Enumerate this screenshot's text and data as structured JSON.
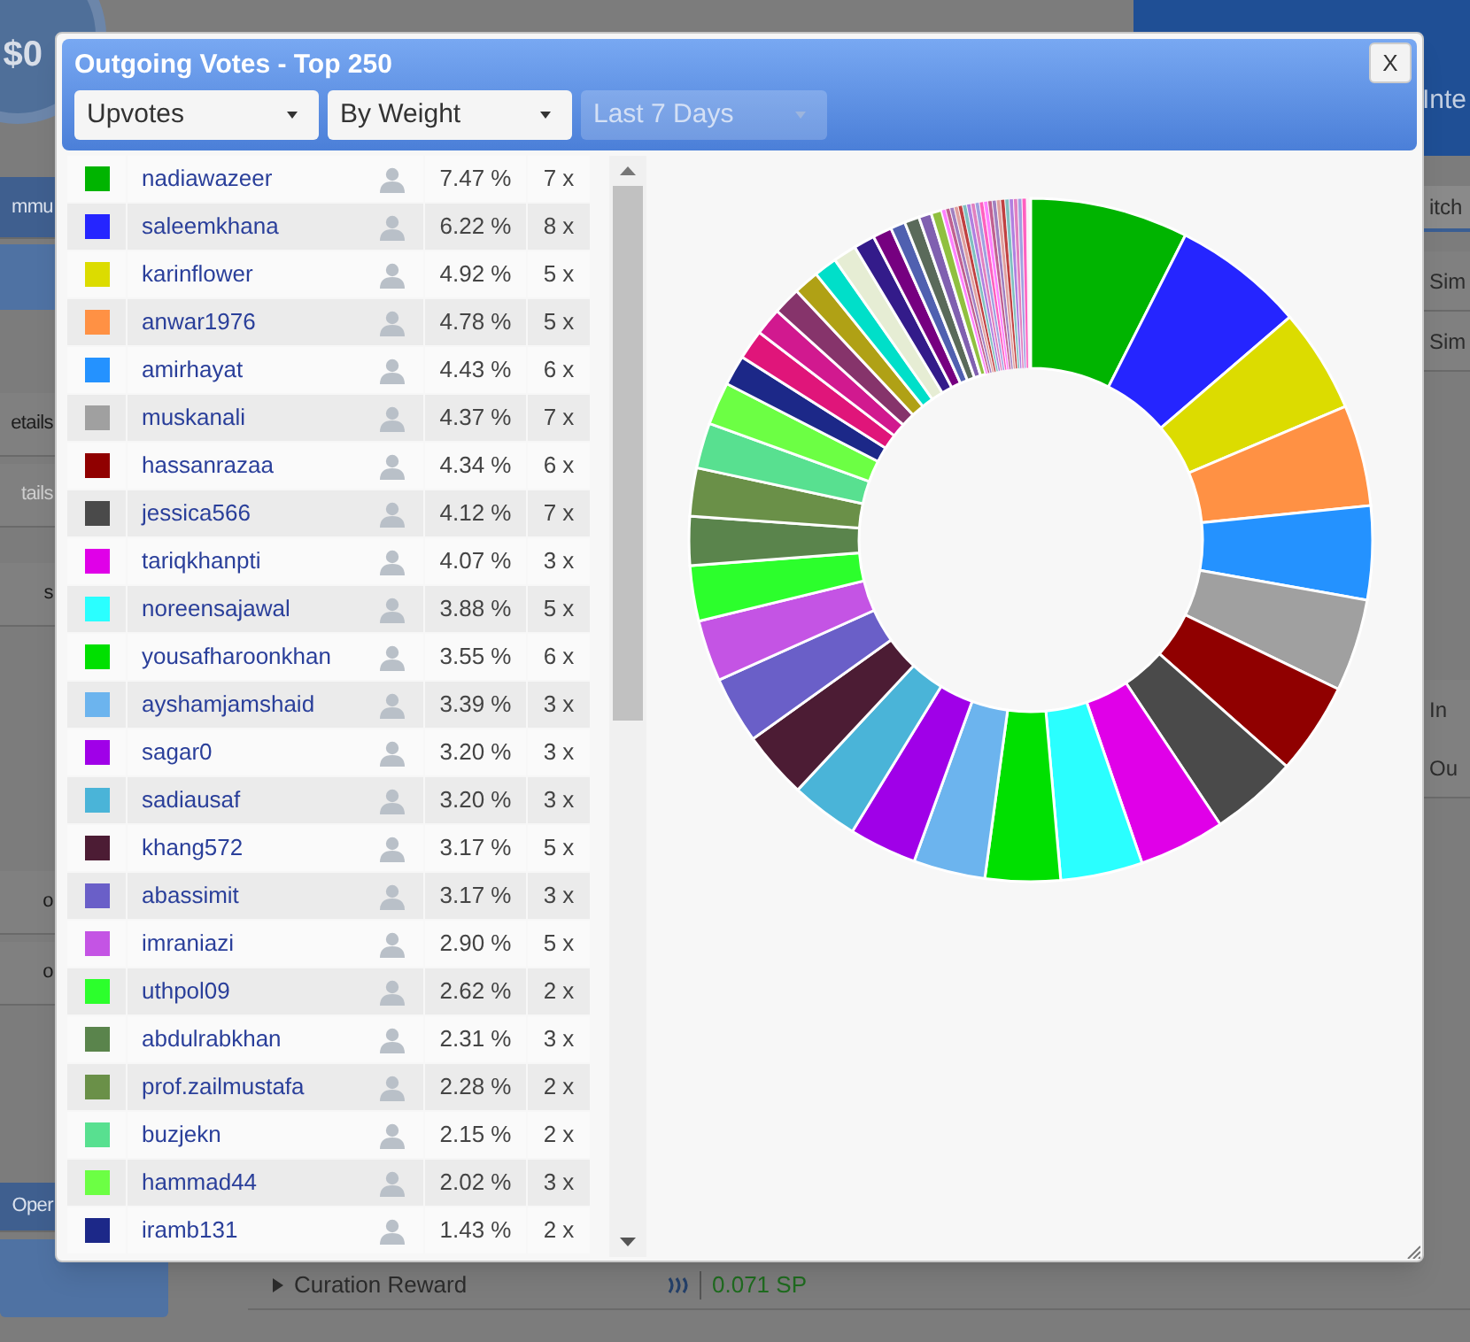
{
  "background_page": {
    "banner": {
      "caption": "Inte"
    },
    "balance": "$0",
    "left_items": [
      {
        "label": "mmu",
        "disabled": false
      },
      {
        "label": "etails",
        "disabled": false
      },
      {
        "label": "tails",
        "disabled": true
      },
      {
        "label": "s",
        "disabled": false
      },
      {
        "label": "o",
        "disabled": false
      },
      {
        "label": "o",
        "disabled": false
      },
      {
        "label": "Oper",
        "disabled": false
      }
    ],
    "right_items": [
      {
        "label": "itch"
      },
      {
        "label": "Sim"
      },
      {
        "label": "Sim"
      },
      {
        "label": "In"
      },
      {
        "label": "Ou"
      }
    ],
    "reward": {
      "label": "Curation Reward",
      "value": "0.071 SP"
    }
  },
  "dialog": {
    "title": "Outgoing Votes - Top 250",
    "close_label": "X",
    "filters": [
      {
        "value": "Upvotes",
        "disabled": false
      },
      {
        "value": "By Weight",
        "disabled": false
      },
      {
        "value": "Last 7 Days",
        "disabled": true
      }
    ]
  },
  "voters": [
    {
      "color": "#00b400",
      "name": "nadiawazeer",
      "share": "7.47 %",
      "votes": "7 x"
    },
    {
      "color": "#2525ff",
      "name": "saleemkhana",
      "share": "6.22 %",
      "votes": "8 x"
    },
    {
      "color": "#dcdc00",
      "name": "karinflower",
      "share": "4.92 %",
      "votes": "5 x"
    },
    {
      "color": "#ff9144",
      "name": "anwar1976",
      "share": "4.78 %",
      "votes": "5 x"
    },
    {
      "color": "#2492ff",
      "name": "amirhayat",
      "share": "4.43 %",
      "votes": "6 x"
    },
    {
      "color": "#a0a0a0",
      "name": "muskanali",
      "share": "4.37 %",
      "votes": "7 x"
    },
    {
      "color": "#900000",
      "name": "hassanrazaa",
      "share": "4.34 %",
      "votes": "6 x"
    },
    {
      "color": "#4a4a4a",
      "name": "jessica566",
      "share": "4.12 %",
      "votes": "7 x"
    },
    {
      "color": "#e000e8",
      "name": "tariqkhanpti",
      "share": "4.07 %",
      "votes": "3 x"
    },
    {
      "color": "#2affff",
      "name": "noreensajawal",
      "share": "3.88 %",
      "votes": "5 x"
    },
    {
      "color": "#00e000",
      "name": "yousafharoonkhan",
      "share": "3.55 %",
      "votes": "6 x"
    },
    {
      "color": "#6cb4ee",
      "name": "ayshamjamshaid",
      "share": "3.39 %",
      "votes": "3 x"
    },
    {
      "color": "#a000e8",
      "name": "sagar0",
      "share": "3.20 %",
      "votes": "3 x"
    },
    {
      "color": "#4ab4d8",
      "name": "sadiausaf",
      "share": "3.20 %",
      "votes": "3 x"
    },
    {
      "color": "#4c1c34",
      "name": "khang572",
      "share": "3.17 %",
      "votes": "5 x"
    },
    {
      "color": "#6a5fc8",
      "name": "abassimit",
      "share": "3.17 %",
      "votes": "3 x"
    },
    {
      "color": "#c454e4",
      "name": "imraniazi",
      "share": "2.90 %",
      "votes": "5 x"
    },
    {
      "color": "#2cff2c",
      "name": "uthpol09",
      "share": "2.62 %",
      "votes": "2 x"
    },
    {
      "color": "#5a844c",
      "name": "abdulrabkhan",
      "share": "2.31 %",
      "votes": "3 x"
    },
    {
      "color": "#6a9048",
      "name": "prof.zailmustafa",
      "share": "2.28 %",
      "votes": "2 x"
    },
    {
      "color": "#58e090",
      "name": "buzjekn",
      "share": "2.15 %",
      "votes": "2 x"
    },
    {
      "color": "#6cff44",
      "name": "hammad44",
      "share": "2.02 %",
      "votes": "3 x"
    },
    {
      "color": "#1c2888",
      "name": "iramb131",
      "share": "1.43 %",
      "votes": "2 x"
    }
  ]
}
